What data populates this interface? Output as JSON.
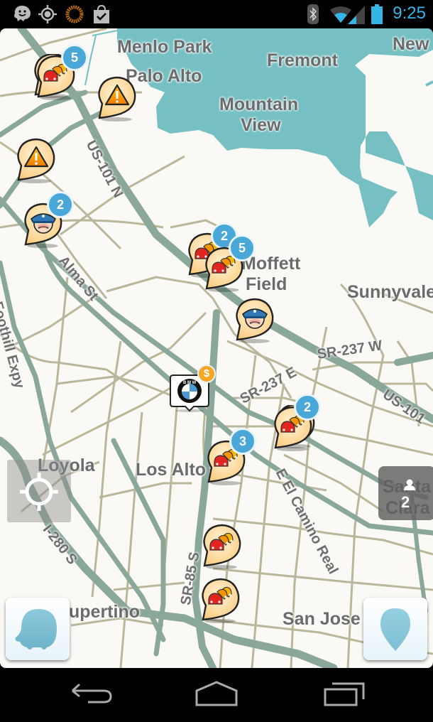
{
  "status_bar": {
    "left_icons": [
      "waze-icon",
      "gps-icon",
      "sync-ring-icon",
      "store-bag-icon"
    ],
    "right_icons": [
      "bluetooth-icon",
      "wifi-icon",
      "signal-icon",
      "battery-icon"
    ],
    "time": "9:25",
    "time_color": "#33b5e5"
  },
  "map": {
    "colors": {
      "land": "#fbf9f5",
      "water": "#76c0c4",
      "highway": "#8aa89a",
      "street": "#b9b79a"
    },
    "place_labels": [
      {
        "id": "menlo-park",
        "text": "Menlo Park"
      },
      {
        "id": "palo-alto",
        "text": "Palo Alto"
      },
      {
        "id": "fremont",
        "text": "Fremont"
      },
      {
        "id": "newark",
        "text": "New"
      },
      {
        "id": "mountain-view-1",
        "text": "Mountain"
      },
      {
        "id": "mountain-view-2",
        "text": "View"
      },
      {
        "id": "moffett-1",
        "text": "Moffett"
      },
      {
        "id": "moffett-2",
        "text": "Field"
      },
      {
        "id": "sunnyvale",
        "text": "Sunnyvale"
      },
      {
        "id": "loyola",
        "text": "Loyola"
      },
      {
        "id": "los-altos",
        "text": "Los Alto"
      },
      {
        "id": "santa-clara-1",
        "text": "Santa"
      },
      {
        "id": "santa-clara-2",
        "text": "Clara"
      },
      {
        "id": "cupertino",
        "text": "upertino"
      },
      {
        "id": "san-jose",
        "text": "San Jose"
      }
    ],
    "road_labels": [
      {
        "id": "us101n",
        "text": "US-101 N"
      },
      {
        "id": "alma",
        "text": "Alma St"
      },
      {
        "id": "foothill",
        "text": "Foothill Expy"
      },
      {
        "id": "sr237w",
        "text": "SR-237 W"
      },
      {
        "id": "sr237e",
        "text": "SR-237 E"
      },
      {
        "id": "us101",
        "text": "US-101"
      },
      {
        "id": "elcamino",
        "text": "E El Camino Real"
      },
      {
        "id": "i280s",
        "text": "I-280 S"
      },
      {
        "id": "sr85",
        "text": "SR-85 S"
      }
    ],
    "pins": [
      {
        "type": "traffic-jam",
        "badge": "5"
      },
      {
        "type": "hazard",
        "badge": null
      },
      {
        "type": "hazard",
        "badge": null
      },
      {
        "type": "police",
        "badge": "2"
      },
      {
        "type": "traffic-jam",
        "badge": "2"
      },
      {
        "type": "traffic-jam",
        "badge": "5"
      },
      {
        "type": "police",
        "badge": null
      },
      {
        "type": "traffic-jam",
        "badge": "2"
      },
      {
        "type": "traffic-jam",
        "badge": "3"
      },
      {
        "type": "traffic-jam",
        "badge": null
      },
      {
        "type": "traffic-jam",
        "badge": null
      }
    ],
    "sponsored_pin": {
      "brand": "BMW",
      "badge": "$"
    },
    "nearby_users": {
      "count": "2"
    }
  },
  "controls": {
    "locate_me": "crosshair-icon",
    "menu_button": "waze-menu",
    "report_button": "report-pin"
  },
  "nav_bar": [
    "back",
    "home",
    "recents"
  ]
}
